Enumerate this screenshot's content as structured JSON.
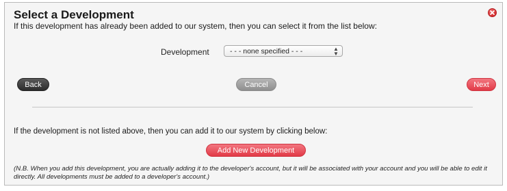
{
  "dialog": {
    "title": "Select a Development",
    "intro": "If this development has already been added to our system, then you can select it from the list below:",
    "close_icon": "close-icon",
    "development": {
      "label": "Development",
      "selected": "- - - none specified - - -",
      "arrow_icon": "select-arrows-icon"
    },
    "buttons": {
      "back": "Back",
      "cancel": "Cancel",
      "next": "Next",
      "add_new": "Add New Development"
    },
    "not_listed": "If the development is not listed above, then you can add it to our system by clicking below:",
    "note": "(N.B. When you add this development, you are actually adding it to the developer's account, but it will be associated with your account and you will be able to edit it directly. All developments must be added to a developer's account.)"
  },
  "colors": {
    "accent_red": "#e23a47",
    "back_dark": "#2c2c2c",
    "cancel_gray": "#9f9f9f",
    "panel_bg": "#f5f5f5"
  }
}
